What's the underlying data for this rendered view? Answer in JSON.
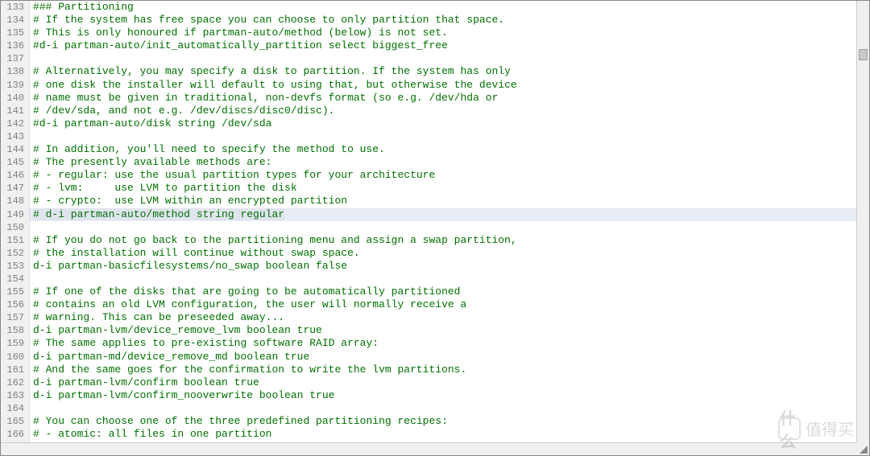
{
  "editor": {
    "first_line_number": 133,
    "highlighted_index": 16,
    "lines": [
      "### Partitioning",
      "# If the system has free space you can choose to only partition that space.",
      "# This is only honoured if partman-auto/method (below) is not set.",
      "#d-i partman-auto/init_automatically_partition select biggest_free",
      "",
      "# Alternatively, you may specify a disk to partition. If the system has only",
      "# one disk the installer will default to using that, but otherwise the device",
      "# name must be given in traditional, non-devfs format (so e.g. /dev/hda or",
      "# /dev/sda, and not e.g. /dev/discs/disc0/disc).",
      "#d-i partman-auto/disk string /dev/sda",
      "",
      "# In addition, you'll need to specify the method to use.",
      "# The presently available methods are:",
      "# - regular: use the usual partition types for your architecture",
      "# - lvm:     use LVM to partition the disk",
      "# - crypto:  use LVM within an encrypted partition",
      "# d-i partman-auto/method string regular",
      "",
      "# If you do not go back to the partitioning menu and assign a swap partition,",
      "# the installation will continue without swap space.",
      "d-i partman-basicfilesystems/no_swap boolean false",
      "",
      "# If one of the disks that are going to be automatically partitioned",
      "# contains an old LVM configuration, the user will normally receive a",
      "# warning. This can be preseeded away...",
      "d-i partman-lvm/device_remove_lvm boolean true",
      "# The same applies to pre-existing software RAID array:",
      "d-i partman-md/device_remove_md boolean true",
      "# And the same goes for the confirmation to write the lvm partitions.",
      "d-i partman-lvm/confirm boolean true",
      "d-i partman-lvm/confirm_nooverwrite boolean true",
      "",
      "# You can choose one of the three predefined partitioning recipes:",
      "# - atomic: all files in one partition"
    ]
  },
  "watermark": {
    "text": "值得买",
    "icon_text": "什么"
  }
}
